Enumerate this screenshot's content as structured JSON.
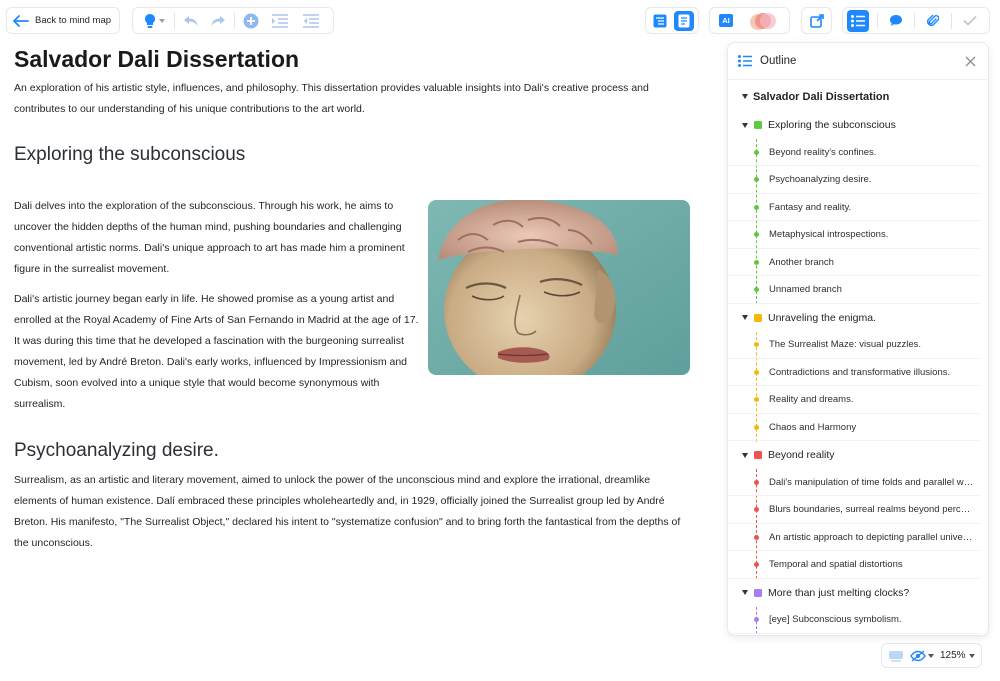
{
  "toolbar": {
    "back_label": "Back to mind map",
    "ai_label": "AI"
  },
  "doc": {
    "title": "Salvador Dali Dissertation",
    "intro": "An exploration of his artistic style, influences, and philosophy. This dissertation provides valuable insights into Dali's creative process and contributes to our understanding of his unique contributions to the art world.",
    "section1_title": "Exploring the subconscious",
    "section1_p1": "Dali delves into the exploration of the subconscious. Through his work, he aims to uncover the hidden depths of the human mind, pushing boundaries and challenging conventional artistic norms. Dali's unique approach to art has made him a prominent figure in the surrealist movement.",
    "section1_p2": "Dali's artistic journey began early in life. He showed promise as a young artist and enrolled at the Royal Academy of Fine Arts of San Fernando in Madrid at the age of 17. It was during this time that he developed a fascination with the burgeoning surrealist movement, led by André Breton. Dali's early works, influenced by Impressionism and Cubism, soon evolved into a unique style that would become synonymous with surrealism.",
    "section2_title": "Psychoanalyzing desire.",
    "section2_p1": "Surrealism, as an artistic and literary movement, aimed to unlock the power of the unconscious mind and explore the irrational, dreamlike elements of human existence. Dalí embraced these principles wholeheartedly and, in 1929, officially joined the Surrealist group led by André Breton. His manifesto, \"The Surrealist Object,\" declared his intent to \"systematize confusion\" and to bring forth the fantastical from the depths of the unconscious."
  },
  "outline": {
    "title": "Outline",
    "root": "Salvador Dali Dissertation",
    "sections": [
      {
        "label": "Exploring the subconscious",
        "color": "#5cc93e",
        "items": [
          "Beyond reality's confines.",
          "Psychoanalyzing desire.",
          "Fantasy and reality.",
          "Metaphysical introspections.",
          "Another branch",
          "Unnamed branch"
        ]
      },
      {
        "label": "Unraveling the enigma.",
        "color": "#f5b80f",
        "items": [
          "The Surrealist Maze: visual puzzles.",
          "Contradictions and transformative illusions.",
          "Reality and dreams.",
          "Chaos and Harmony"
        ]
      },
      {
        "label": "Beyond reality",
        "color": "#ef5350",
        "items": [
          "Dali's manipulation of time folds and parallel worlds.",
          "Blurs boundaries, surreal realms beyond perception.",
          "An artistic approach to depicting parallel universes.",
          "Temporal and spatial distortions"
        ]
      },
      {
        "label": "More than just melting clocks?",
        "color": "#a77cf5",
        "items": [
          "[eye] Subconscious symbolism."
        ]
      }
    ]
  },
  "zoom": "125%"
}
